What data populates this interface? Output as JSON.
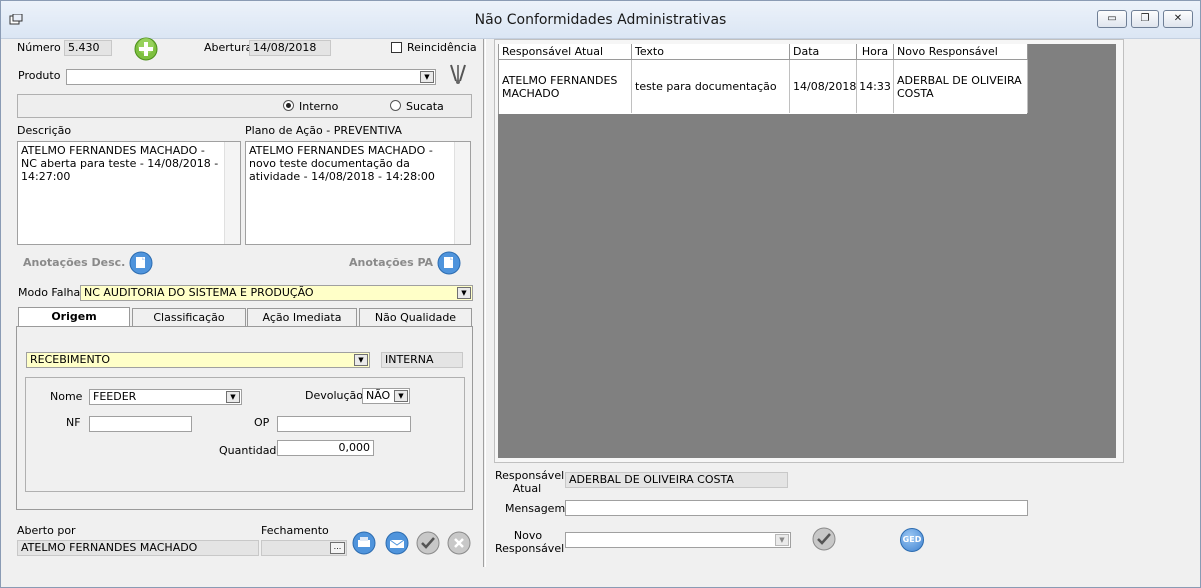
{
  "window": {
    "title": "Não Conformidades Administrativas",
    "minimize_glyph": "▭",
    "restore_glyph": "❐",
    "close_glyph": "✕"
  },
  "header": {
    "numero_label": "Número",
    "numero_value": "5.430",
    "abertura_label": "Abertura",
    "abertura_value": "14/08/2018",
    "reincidencia_label": "Reincidência",
    "produto_label": "Produto",
    "produto_value": ""
  },
  "tipo": {
    "interno_label": "Interno",
    "sucata_label": "Sucata",
    "selected": "interno"
  },
  "descricao": {
    "label": "Descrição",
    "text": "ATELMO FERNANDES MACHADO - NC aberta para teste - 14/08/2018 - 14:27:00"
  },
  "plano": {
    "label": "Plano de Ação - PREVENTIVA",
    "text": "ATELMO FERNANDES MACHADO - novo teste documentação da atividade - 14/08/2018 - 14:28:00"
  },
  "anotacoes": {
    "desc_label": "Anotações Desc.",
    "pa_label": "Anotações PA"
  },
  "modo_falha": {
    "label": "Modo Falha",
    "value": "NC AUDITORIA DO SISTEMA E PRODUÇÃO"
  },
  "tabs": [
    {
      "label": "Origem",
      "active": true
    },
    {
      "label": "Classificação",
      "active": false
    },
    {
      "label": "Ação Imediata",
      "active": false
    },
    {
      "label": "Não Qualidade",
      "active": false
    }
  ],
  "origem": {
    "tipo_value": "RECEBIMENTO",
    "interna_value": "INTERNA",
    "nome_label": "Nome",
    "nome_value": "FEEDER",
    "devolucao_label": "Devolução",
    "devolucao_value": "NÃO",
    "nf_label": "NF",
    "nf_value": "",
    "op_label": "OP",
    "op_value": "",
    "quantidade_label": "Quantidade",
    "quantidade_value": "0,000"
  },
  "footer": {
    "aberto_por_label": "Aberto por",
    "aberto_por_value": "ATELMO FERNANDES MACHADO",
    "fechamento_label": "Fechamento",
    "fechamento_value": "",
    "ellipsis": "..."
  },
  "grid": {
    "headers": [
      "Responsável Atual",
      "Texto",
      "Data",
      "Hora",
      "Novo Responsável"
    ],
    "rows": [
      [
        "ATELMO FERNANDES MACHADO",
        "teste para documentação",
        "14/08/2018",
        "14:33",
        "ADERBAL DE OLIVEIRA COSTA"
      ]
    ]
  },
  "right_form": {
    "resp_atual_label": "Responsável Atual",
    "resp_atual_value": "ADERBAL DE OLIVEIRA COSTA",
    "mensagem_label": "Mensagem",
    "mensagem_value": "",
    "novo_resp_label": "Novo Responsável",
    "novo_resp_value": "",
    "ged_label": "GED"
  }
}
